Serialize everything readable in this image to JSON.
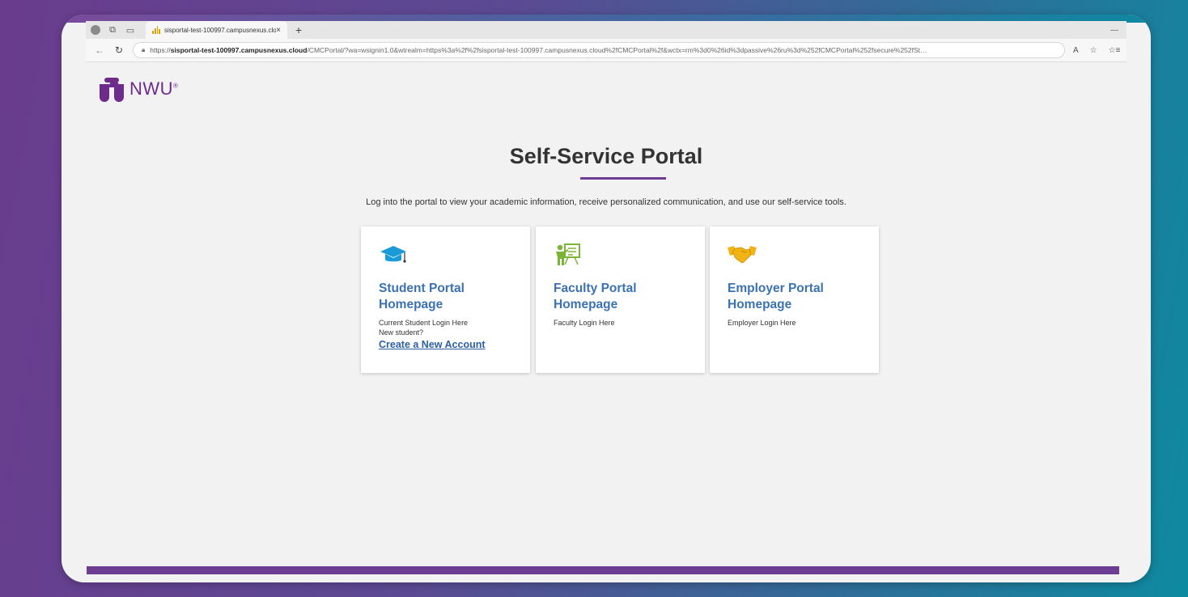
{
  "browser": {
    "tab_title": "sisportal-test-100997.campusnexus.cloud",
    "tab_close": "×",
    "new_tab": "+",
    "minimize": "—",
    "url_scheme": "https://",
    "url_host": "sisportal-test-100997.campusnexus.cloud",
    "url_path": "/CMCPortal/?wa=wsignin1.0&wtrealm=https%3a%2f%2fsisportal-test-100997.campusnexus.cloud%2fCMCPortal%2f&wctx=rm%3d0%26id%3dpassive%26ru%3d%252fCMCPortal%252fsecure%252fSt…",
    "read_aloud": "A",
    "favorite": "☆",
    "favorites_bar": "☆≡"
  },
  "logo": {
    "text": "NWU",
    "reg": "®",
    "color": "#6d2b8c"
  },
  "page": {
    "title": "Self-Service Portal",
    "subtitle": "Log into the portal to view your academic information, receive personalized communication, and use our self-service tools."
  },
  "cards": [
    {
      "icon": "graduation-cap-icon",
      "title_line1": "Student Portal",
      "title_line2": "Homepage",
      "desc_line1": "Current Student Login Here",
      "desc_line2": "New student?",
      "link": "Create a New Account",
      "icon_color": "#1a9ad6"
    },
    {
      "icon": "teacher-board-icon",
      "title_line1": "Faculty Portal",
      "title_line2": "Homepage",
      "desc_line1": "Faculty Login Here",
      "icon_color": "#7ab536"
    },
    {
      "icon": "handshake-icon",
      "title_line1": "Employer Portal",
      "title_line2": "Homepage",
      "desc_line1": "Employer Login Here",
      "icon_color": "#f2b415"
    }
  ],
  "colors": {
    "accent": "#6d3d94",
    "link": "#3a72b2"
  }
}
